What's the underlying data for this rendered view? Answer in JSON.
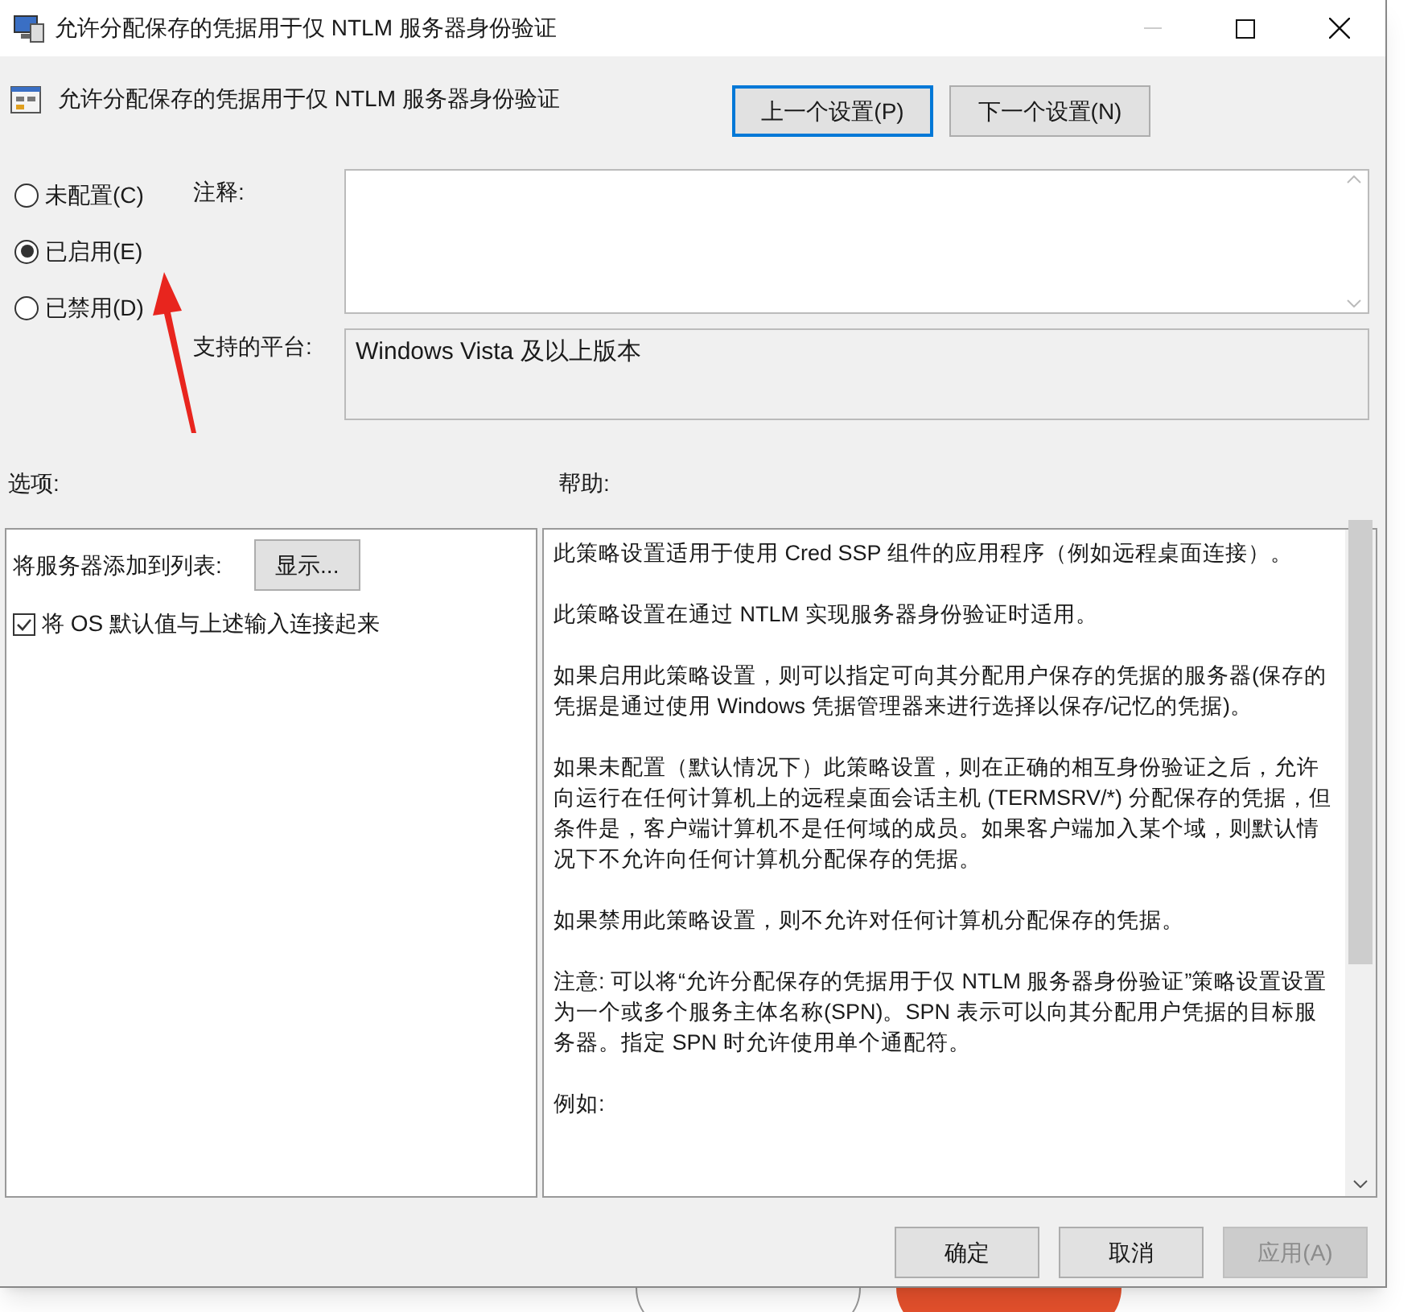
{
  "window": {
    "title": "允许分配保存的凭据用于仅 NTLM 服务器身份验证"
  },
  "header": {
    "title": "允许分配保存的凭据用于仅 NTLM 服务器身份验证",
    "buttons": [
      {
        "label": "上一个设置(P)",
        "focused": true
      },
      {
        "label": "下一个设置(N)",
        "focused": false
      }
    ]
  },
  "radios": [
    {
      "label": "未配置(C)",
      "selected": false
    },
    {
      "label": "已启用(E)",
      "selected": true
    },
    {
      "label": "已禁用(D)",
      "selected": false
    }
  ],
  "comment": {
    "label": "注释:"
  },
  "platform": {
    "label": "支持的平台:",
    "value": "Windows Vista 及以上版本"
  },
  "options": {
    "label": "选项:",
    "items": [
      {
        "kind": "button-row",
        "label": "将服务器添加到列表:",
        "button": "显示..."
      },
      {
        "kind": "checkbox",
        "label": "将 OS 默认值与上述输入连接起来",
        "checked": true
      }
    ]
  },
  "help": {
    "label": "帮助:",
    "paragraphs": [
      "此策略设置适用于使用 Cred SSP 组件的应用程序（例如远程桌面连接）。",
      "此策略设置在通过 NTLM 实现服务器身份验证时适用。",
      "如果启用此策略设置，则可以指定可向其分配用户保存的凭据的服务器(保存的凭据是通过使用 Windows 凭据管理器来进行选择以保存/记忆的凭据)。",
      "如果未配置（默认情况下）此策略设置，则在正确的相互身份验证之后，允许向运行在任何计算机上的远程桌面会话主机 (TERMSRV/*) 分配保存的凭据，但条件是，客户端计算机不是任何域的成员。如果客户端加入某个域，则默认情况下不允许向任何计算机分配保存的凭据。",
      "如果禁用此策略设置，则不允许对任何计算机分配保存的凭据。",
      "注意: 可以将“允许分配保存的凭据用于仅 NTLM 服务器身份验证”策略设置设置为一个或多个服务主体名称(SPN)。SPN 表示可以向其分配用户凭据的目标服务器。指定 SPN 时允许使用单个通配符。",
      "例如:"
    ]
  },
  "buttons": [
    {
      "label": "确定",
      "disabled": false
    },
    {
      "label": "取消",
      "disabled": false
    },
    {
      "label": "应用(A)",
      "disabled": true
    }
  ]
}
